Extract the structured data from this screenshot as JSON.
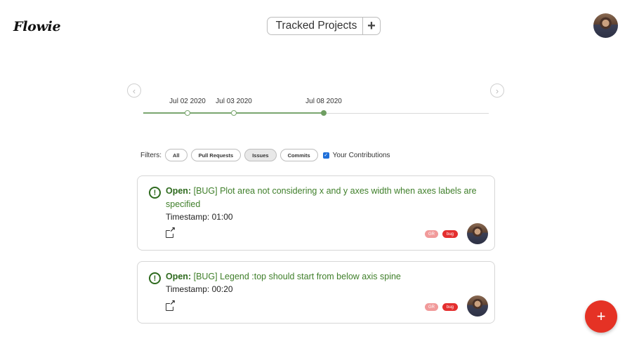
{
  "app": {
    "logo": "Flowie"
  },
  "header": {
    "tracked_label": "Tracked Projects",
    "add_label": "+"
  },
  "timeline": {
    "prev_label": "‹",
    "next_label": "›",
    "dates": [
      "Jul 02 2020",
      "Jul 03 2020",
      "Jul 08 2020"
    ],
    "active_index": 2
  },
  "filters": {
    "label": "Filters:",
    "chips": [
      "All",
      "Pull Requests",
      "Issues",
      "Commits"
    ],
    "active_chip": "Issues",
    "checkbox_label": "Your Contributions",
    "checkbox_checked": true
  },
  "issues": [
    {
      "status": "Open:",
      "title": "[BUG] Plot area not considering x and y axes width when axes labels are specified",
      "timestamp": "Timestamp: 01:00",
      "tags": [
        "GR",
        "bug"
      ]
    },
    {
      "status": "Open:",
      "title": "[BUG] Legend :top should start from below axis spine",
      "timestamp": "Timestamp: 00:20",
      "tags": [
        "GR",
        "bug"
      ]
    }
  ],
  "fab": {
    "label": "+"
  },
  "colors": {
    "accent_green": "#2e6a1e",
    "timeline_green": "#7aa66f",
    "fab_red": "#e53225",
    "bug_red": "#e42f2f"
  }
}
